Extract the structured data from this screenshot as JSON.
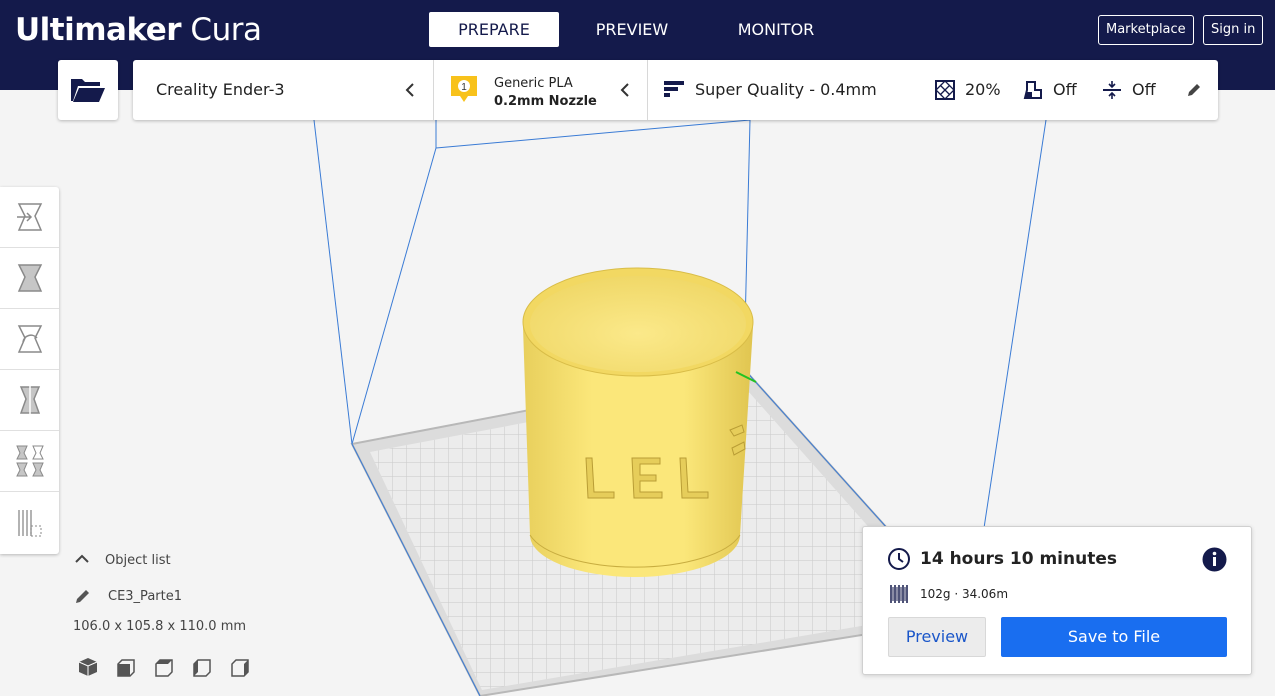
{
  "header": {
    "logo_bold": "Ultimaker",
    "logo_light": "Cura",
    "tabs": [
      {
        "label": "PREPARE",
        "active": true
      },
      {
        "label": "PREVIEW",
        "active": false
      },
      {
        "label": "MONITOR",
        "active": false
      }
    ],
    "marketplace_label": "Marketplace",
    "signin_label": "Sign in"
  },
  "stagebar": {
    "open_icon": "folder-open-icon",
    "printer": "Creality Ender-3",
    "material": {
      "badge": "1",
      "name": "Generic PLA",
      "nozzle": "0.2mm Nozzle",
      "badge_color": "#f8c21b"
    },
    "quality": "Super Quality - 0.4mm",
    "infill": "20%",
    "support": "Off",
    "adhesion": "Off"
  },
  "toolbar": {
    "tools": [
      "move-tool-icon",
      "scale-tool-icon",
      "rotate-tool-icon",
      "mirror-tool-icon",
      "per-model-settings-icon",
      "support-blocker-icon"
    ]
  },
  "object_list": {
    "label": "Object list",
    "object_name": "CE3_Parte1",
    "dimensions": "106.0 x 105.8 x 110.0 mm",
    "views": [
      "view-3d-icon",
      "view-front-icon",
      "view-top-icon",
      "view-left-icon",
      "view-right-icon"
    ]
  },
  "model": {
    "embossed_text": "LEL",
    "color": "#fbe77a"
  },
  "action_panel": {
    "print_time": "14 hours 10 minutes",
    "material_usage": "102g · 34.06m",
    "preview_label": "Preview",
    "save_label": "Save to File"
  },
  "colors": {
    "header_bg": "#141a4b",
    "primary_blue": "#196ef0",
    "build_volume_lines": "#3a7bd5"
  }
}
